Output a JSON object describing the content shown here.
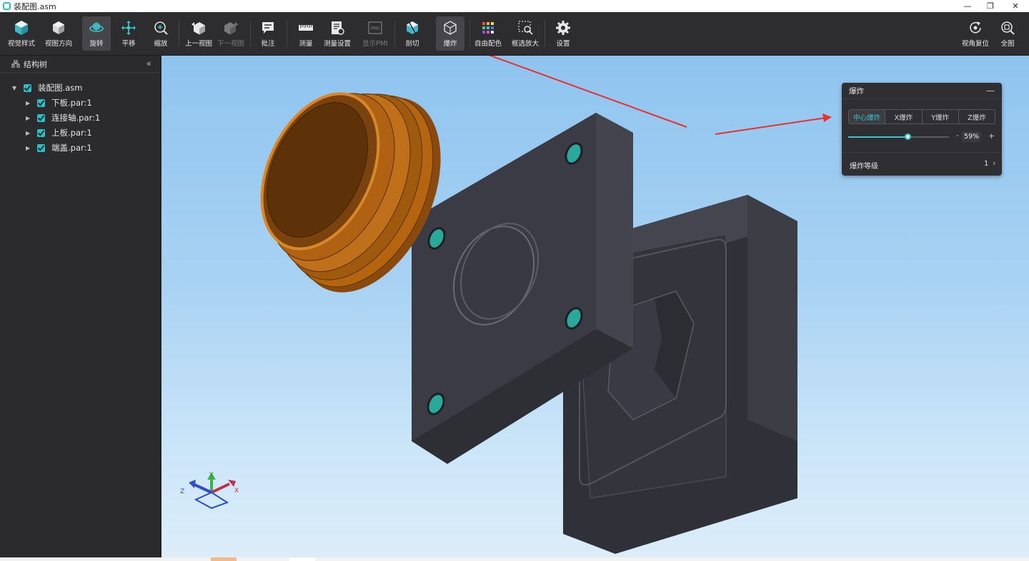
{
  "window": {
    "title": "装配图.asm",
    "controls": {
      "minimize": "—",
      "restore": "❐",
      "close": "✕"
    }
  },
  "toolbar": {
    "items": [
      {
        "label": "视觉样式",
        "icon": "visual-style-icon"
      },
      {
        "label": "视图方向",
        "icon": "view-direction-icon"
      },
      {
        "label": "旋转",
        "icon": "rotate-icon"
      },
      {
        "label": "平移",
        "icon": "pan-icon"
      },
      {
        "label": "缩放",
        "icon": "zoom-icon"
      },
      {
        "label": "上一视图",
        "icon": "previous-view-icon"
      },
      {
        "label": "下一视图",
        "icon": "next-view-icon"
      },
      {
        "label": "批注",
        "icon": "annotation-icon"
      },
      {
        "label": "测量",
        "icon": "measure-icon"
      },
      {
        "label": "测量设置",
        "icon": "measure-settings-icon"
      },
      {
        "label": "显示PMI",
        "icon": "show-pmi-icon",
        "icon_text": "PMI"
      },
      {
        "label": "剖切",
        "icon": "section-icon"
      },
      {
        "label": "爆炸",
        "icon": "explode-icon"
      },
      {
        "label": "自由配色",
        "icon": "free-color-icon"
      },
      {
        "label": "框选放大",
        "icon": "box-zoom-icon"
      },
      {
        "label": "设置",
        "icon": "settings-icon"
      },
      {
        "label": "视角复位",
        "icon": "reset-view-icon"
      },
      {
        "label": "全图",
        "icon": "fit-all-icon"
      }
    ]
  },
  "sidebar": {
    "title": "结构树",
    "collapse": "«",
    "tree": {
      "root": "装配图.asm",
      "children": [
        "下板.par:1",
        "连接轴.par:1",
        "上板.par:1",
        "端盖.par:1"
      ]
    }
  },
  "viewport": {
    "axis": {
      "x": "X",
      "y": "Y",
      "z": "Z"
    }
  },
  "explode_panel": {
    "title": "爆炸",
    "minimize": "—",
    "modes": [
      "中心爆炸",
      "X爆炸",
      "Y爆炸",
      "Z爆炸"
    ],
    "active_mode": "中心爆炸",
    "slider_fraction": 0.59,
    "value_text": "59%",
    "minus": "-",
    "plus": "+",
    "level_label": "爆炸等级",
    "level_value": "1",
    "chevron": "›"
  },
  "colors": {
    "accent": "#37c6cf",
    "toolbar_bg": "#2d2d30",
    "annotation_arrow": "#e8312c",
    "end_cap": "#b5650f",
    "plate": "#3b3b44",
    "hole": "#2aa89a"
  }
}
